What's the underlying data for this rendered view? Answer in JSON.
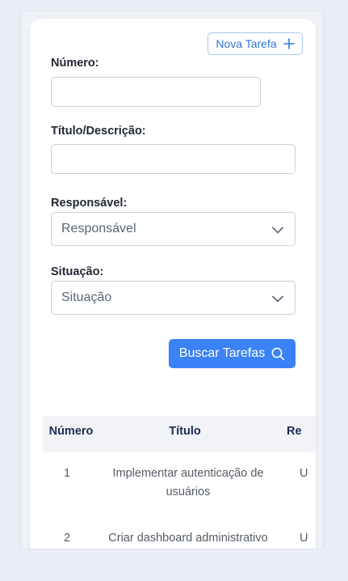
{
  "toolbar": {
    "new_task_label": "Nova Tarefa"
  },
  "filters": {
    "number_label": "Número:",
    "number_value": "",
    "title_label": "Título/Descrição:",
    "title_value": "",
    "responsible_label": "Responsável:",
    "responsible_selected": "Responsável",
    "status_label": "Situação:",
    "status_selected": "Situação",
    "search_button_label": "Buscar Tarefas"
  },
  "table": {
    "columns": [
      "Número",
      "Título",
      "Re"
    ],
    "rows": [
      {
        "numero": "1",
        "titulo": "Implementar autenticação de usuários",
        "resp": "U"
      },
      {
        "numero": "2",
        "titulo": "Criar dashboard administrativo",
        "resp": "U"
      }
    ]
  },
  "colors": {
    "accent": "#3b82f6",
    "header_text": "#1f2a55",
    "background": "#eaeef7"
  },
  "icons": {
    "add": "plus-icon",
    "search": "search-icon",
    "dropdown": "chevron-down-icon"
  }
}
